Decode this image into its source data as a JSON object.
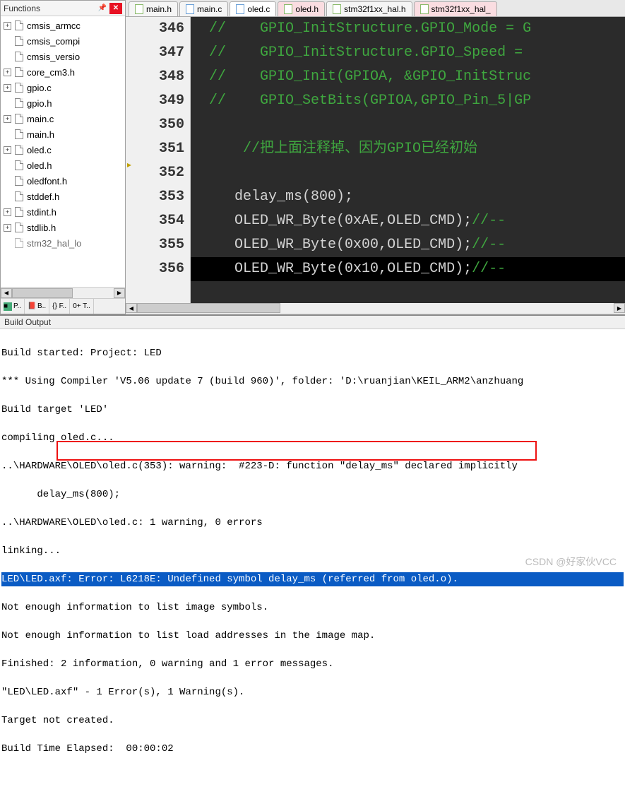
{
  "functions": {
    "title": "Functions",
    "items": [
      {
        "label": "cmsis_armcc",
        "expandable": true
      },
      {
        "label": "cmsis_compi",
        "expandable": false
      },
      {
        "label": "cmsis_versio",
        "expandable": false
      },
      {
        "label": "core_cm3.h",
        "expandable": true
      },
      {
        "label": "gpio.c",
        "expandable": true
      },
      {
        "label": "gpio.h",
        "expandable": false
      },
      {
        "label": "main.c",
        "expandable": true
      },
      {
        "label": "main.h",
        "expandable": false
      },
      {
        "label": "oled.c",
        "expandable": true
      },
      {
        "label": "oled.h",
        "expandable": false
      },
      {
        "label": "oledfont.h",
        "expandable": false
      },
      {
        "label": "stddef.h",
        "expandable": false
      },
      {
        "label": "stdint.h",
        "expandable": true
      },
      {
        "label": "stdlib.h",
        "expandable": true
      },
      {
        "label": "stm32_hal_lo",
        "expandable": false
      }
    ]
  },
  "bottom_tabs": {
    "t1": "P..",
    "t2": "B..",
    "t3": "{} F..",
    "t4": "0+ T.."
  },
  "editor_tabs": [
    {
      "label": "main.h",
      "kind": "h",
      "active": false
    },
    {
      "label": "main.c",
      "kind": "c",
      "active": false
    },
    {
      "label": "oled.c",
      "kind": "c",
      "active": true
    },
    {
      "label": "oled.h",
      "kind": "h",
      "active": false,
      "pink": true
    },
    {
      "label": "stm32f1xx_hal.h",
      "kind": "h",
      "active": false
    },
    {
      "label": "stm32f1xx_hal_",
      "kind": "h",
      "active": false,
      "pink": true
    }
  ],
  "gutter": [
    "346",
    "347",
    "348",
    "349",
    "350",
    "351",
    "352",
    "353",
    "354",
    "355",
    "356"
  ],
  "code": {
    "l346": " //    GPIO_InitStructure.GPIO_Mode = G",
    "l347": " //    GPIO_InitStructure.GPIO_Speed = ",
    "l348": " //    GPIO_Init(GPIOA, &GPIO_InitStruc",
    "l349": " //    GPIO_SetBits(GPIOA,GPIO_Pin_5|GP",
    "l350": "",
    "l351": "     //把上面注释掉、因为GPIO已经初始",
    "l352": "",
    "l353a": "    delay_ms(",
    "l353b": "800",
    "l353c": ");",
    "l354a": "    OLED_WR_Byte(",
    "l354b": "0xAE",
    "l354c": ",OLED_CMD);",
    "l354d": "//--",
    "l355a": "    OLED_WR_Byte(",
    "l355b": "0x00",
    "l355c": ",OLED_CMD);",
    "l355d": "//--",
    "l356a": "    OLED_WR_Byte(",
    "l356b": "0x10",
    "l356c": ",OLED_CMD);",
    "l356d": "//--"
  },
  "build": {
    "title": "Build Output",
    "lines": [
      "Build started: Project: LED",
      "*** Using Compiler 'V5.06 update 7 (build 960)', folder: 'D:\\ruanjian\\KEIL_ARM2\\anzhuang",
      "Build target 'LED'",
      "compiling oled.c...",
      "..\\HARDWARE\\OLED\\oled.c(353): warning:  #223-D: function \"delay_ms\" declared implicitly",
      "      delay_ms(800);",
      "..\\HARDWARE\\OLED\\oled.c: 1 warning, 0 errors",
      "linking...",
      "LED\\LED.axf: Error: L6218E: Undefined symbol delay_ms (referred from oled.o).",
      "Not enough information to list image symbols.",
      "Not enough information to list load addresses in the image map.",
      "Finished: 2 information, 0 warning and 1 error messages.",
      "\"LED\\LED.axf\" - 1 Error(s), 1 Warning(s).",
      "Target not created.",
      "Build Time Elapsed:  00:00:02"
    ]
  },
  "watermark": "CSDN @好家伙VCC"
}
